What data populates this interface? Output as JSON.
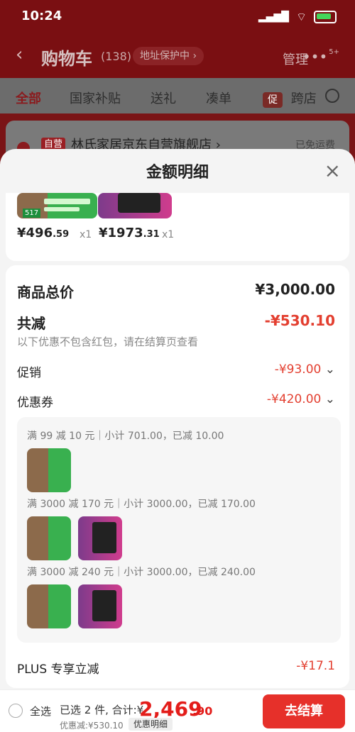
{
  "status_bar": {
    "time": "10:24"
  },
  "header": {
    "back_icon": "chevron-left-icon",
    "title": "购物车",
    "count": "(138)",
    "address_protection": "地址保护中 ›",
    "manage": "管理",
    "more_badge": "5+"
  },
  "tabs": [
    {
      "label": "全部"
    },
    {
      "label": "国家补贴"
    },
    {
      "label": "送礼"
    },
    {
      "label": "凑单"
    },
    {
      "label": "跨店"
    }
  ],
  "store": {
    "badge": "自营",
    "name": "林氏家居京东自营旗舰店 ›",
    "shipping": "已免运费"
  },
  "modal": {
    "title": "金额明细",
    "products": [
      {
        "price_main": "¥496",
        "price_cents": ".59",
        "qty": "x1"
      },
      {
        "price_main": "¥1973",
        "price_cents": ".31",
        "qty": "x1"
      }
    ],
    "total_label": "商品总价",
    "total_value": "¥3,000.00",
    "reduction_label": "共减",
    "reduction_value": "-¥530.10",
    "reduction_note": "以下优惠不包含红包，请在结算页查看",
    "promo_label": "促销",
    "promo_value": "-¥93.00",
    "coupon_label": "优惠券",
    "coupon_value": "-¥420.00",
    "coupon_items": [
      {
        "text": "满 99 减 10 元｜小计 701.00，已减 10.00"
      },
      {
        "text": "满 3000 减 170 元｜小计 3000.00，已减 170.00"
      },
      {
        "text": "满 3000 减 240 元｜小计 3000.00，已减 240.00"
      }
    ],
    "plus_label": "PLUS 专享立减",
    "plus_value": "-¥17.1"
  },
  "bottom_bar": {
    "select_all": "全选",
    "summary": "已选 2 件, 合计:¥",
    "total_main": "2,469",
    "total_cents": ".90",
    "discount": "优惠减:¥530.10",
    "detail_button": "优惠明细",
    "checkout": "去结算"
  }
}
